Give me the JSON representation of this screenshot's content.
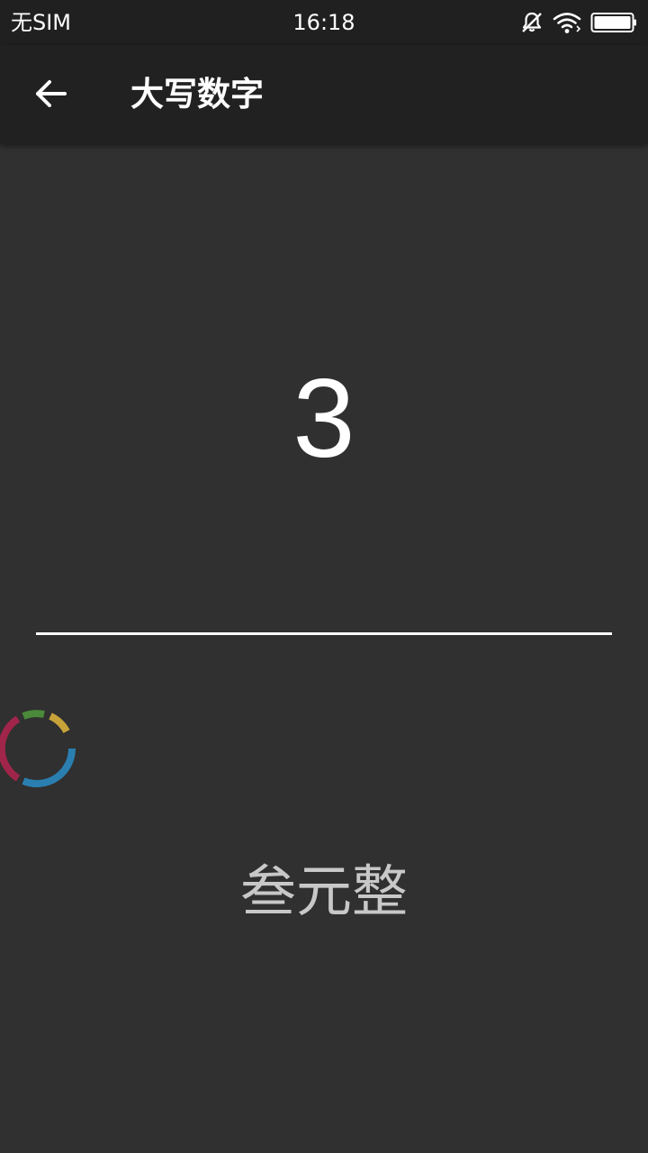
{
  "status_bar": {
    "carrier": "无SIM",
    "time": "16:18",
    "icons": [
      "muted-bell-icon",
      "wifi-icon",
      "battery-icon"
    ]
  },
  "app_bar": {
    "back_icon": "arrow-left-icon",
    "title": "大写数字"
  },
  "main": {
    "number_value": "3",
    "chinese_uppercase": "叁元整"
  },
  "floating_widget": {
    "icon": "color-ring-icon",
    "colors": [
      "#2a7fb0",
      "#a0254a",
      "#4a8a3a",
      "#c8a33a"
    ]
  },
  "colors": {
    "background": "#303030",
    "app_bar": "#212121",
    "status_bar": "#202020",
    "text_primary": "#ffffff",
    "text_secondary": "#c8c8c8"
  }
}
